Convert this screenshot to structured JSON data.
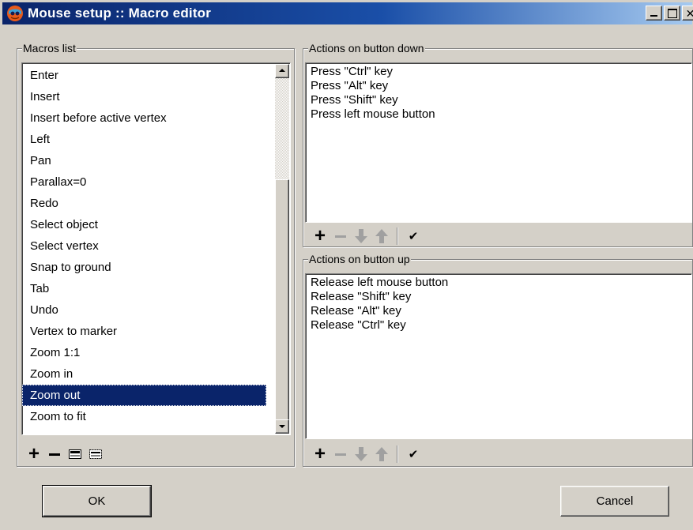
{
  "window": {
    "title": "Mouse setup :: Macro editor"
  },
  "macros": {
    "group_label": "Macros list",
    "items": [
      "Enter",
      "Insert",
      "Insert before active vertex",
      "Left",
      "Pan",
      "Parallax=0",
      "Redo",
      "Select object",
      "Select vertex",
      "Snap to ground",
      "Tab",
      "Undo",
      "Vertex to marker",
      "Zoom 1:1",
      "Zoom in",
      "Zoom out",
      "Zoom to fit"
    ],
    "selected": "Zoom out",
    "toolbar": [
      "plus-icon",
      "minus-icon",
      "rename-icon",
      "copy-icon"
    ]
  },
  "actions_down": {
    "group_label": "Actions on button down",
    "items": [
      "Press \"Ctrl\" key",
      "Press \"Alt\" key",
      "Press \"Shift\" key",
      "Press left mouse button"
    ],
    "toolbar": [
      "plus-icon",
      "minus-icon",
      "arrow-down-icon",
      "arrow-up-icon",
      "checkmark-icon"
    ]
  },
  "actions_up": {
    "group_label": "Actions on button up",
    "items": [
      "Release left mouse button",
      "Release \"Shift\" key",
      "Release \"Alt\" key",
      "Release \"Ctrl\" key"
    ],
    "toolbar": [
      "plus-icon",
      "minus-icon",
      "arrow-down-icon",
      "arrow-up-icon",
      "checkmark-icon"
    ]
  },
  "buttons": {
    "ok": "OK",
    "cancel": "Cancel"
  },
  "colors": {
    "face": "#d4d0c8",
    "selection": "#0a246a",
    "title_start": "#0a246a",
    "title_end": "#a6caf0",
    "disabled_icon": "#a0a0a0"
  }
}
